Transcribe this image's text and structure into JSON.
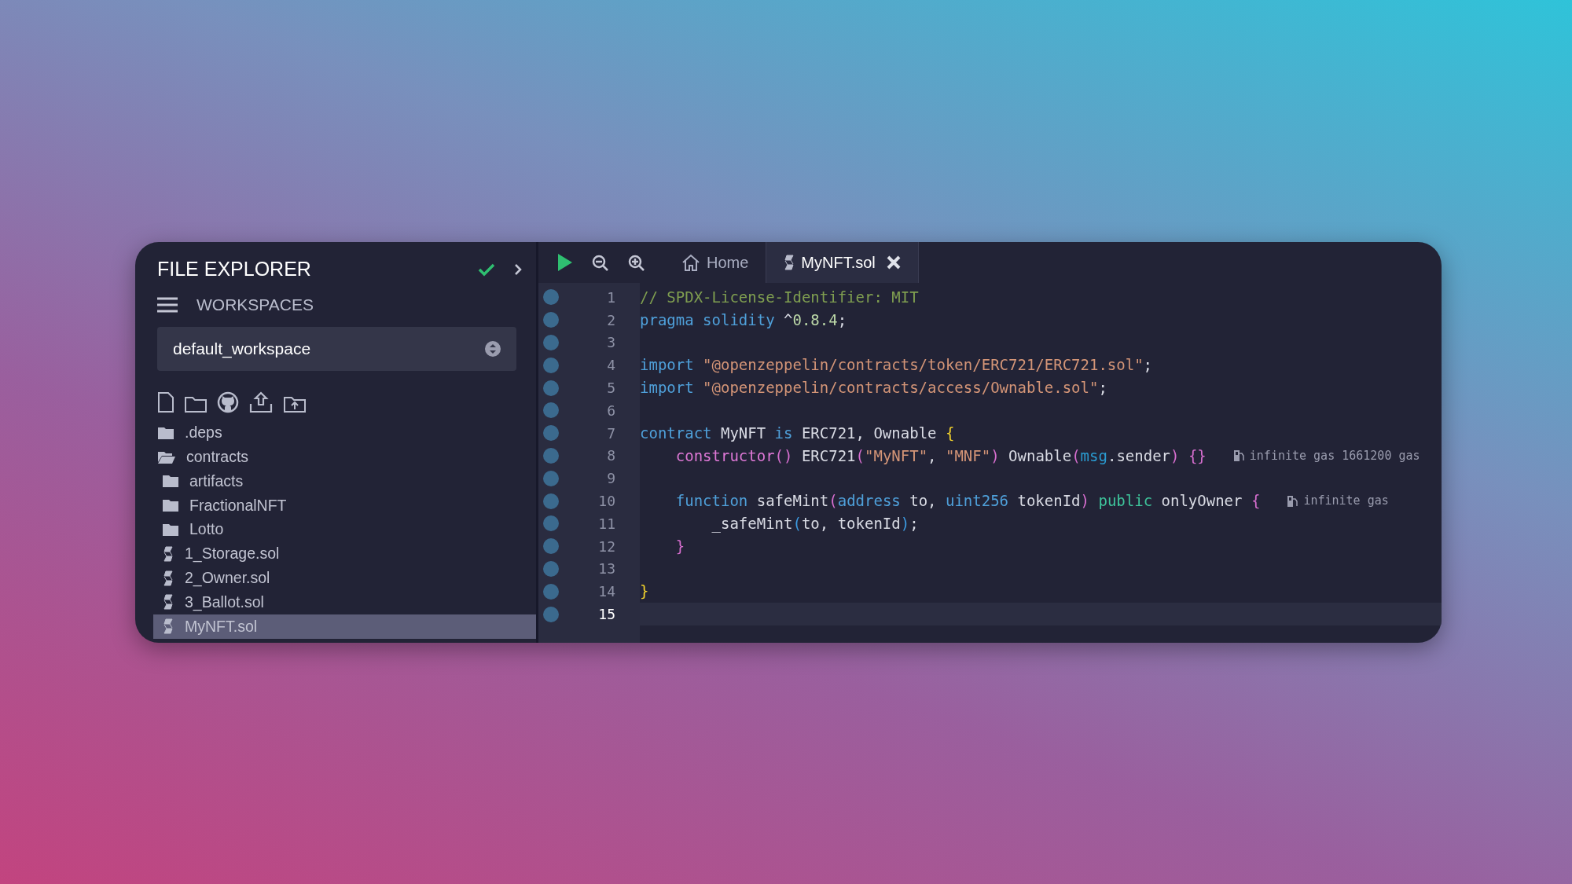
{
  "sidebar": {
    "title": "FILE EXPLORER",
    "section": "WORKSPACES",
    "workspace": "default_workspace",
    "tree": [
      {
        "kind": "folder",
        "label": ".deps",
        "expanded": false,
        "selected": false
      },
      {
        "kind": "folder",
        "label": "contracts",
        "expanded": true,
        "selected": false,
        "children": [
          {
            "kind": "folder",
            "label": "artifacts",
            "expanded": false,
            "selected": false
          },
          {
            "kind": "folder",
            "label": "FractionalNFT",
            "expanded": false,
            "selected": false
          },
          {
            "kind": "folder",
            "label": "Lotto",
            "expanded": false,
            "selected": false
          },
          {
            "kind": "file",
            "label": "1_Storage.sol",
            "selected": false
          },
          {
            "kind": "file",
            "label": "2_Owner.sol",
            "selected": false
          },
          {
            "kind": "file",
            "label": "3_Ballot.sol",
            "selected": false
          },
          {
            "kind": "file",
            "label": "MyNFT.sol",
            "selected": true
          }
        ]
      }
    ]
  },
  "editor": {
    "tabs": [
      {
        "kind": "home",
        "label": "Home",
        "selected": false,
        "closable": false
      },
      {
        "kind": "file",
        "label": "MyNFT.sol",
        "selected": true,
        "closable": true
      }
    ],
    "lines": [
      {
        "number": "1",
        "current": false,
        "tokens": [
          {
            "kind": "comment",
            "text": "// SPDX-License-Identifier: MIT"
          }
        ]
      },
      {
        "number": "2",
        "current": false,
        "tokens": [
          {
            "kind": "keyword",
            "text": "pragma"
          },
          {
            "kind": "keyword",
            "text": " solidity"
          },
          {
            "kind": "plain",
            "text": " ^"
          },
          {
            "kind": "number",
            "text": "0.8.4"
          },
          {
            "kind": "plain",
            "text": ";"
          }
        ]
      },
      {
        "number": "3",
        "current": false
      },
      {
        "number": "4",
        "current": false,
        "tokens": [
          {
            "kind": "keyword",
            "text": "import"
          },
          {
            "kind": "string",
            "text": " \"@openzeppelin/contracts/token/ERC721/ERC721.sol\""
          },
          {
            "kind": "plain",
            "text": ";"
          }
        ]
      },
      {
        "number": "5",
        "current": false,
        "tokens": [
          {
            "kind": "keyword",
            "text": "import"
          },
          {
            "kind": "string",
            "text": " \"@openzeppelin/contracts/access/Ownable.sol\""
          },
          {
            "kind": "plain",
            "text": ";"
          }
        ]
      },
      {
        "number": "6",
        "current": false
      },
      {
        "number": "7",
        "current": false,
        "tokens": [
          {
            "kind": "keyword",
            "text": "contract"
          },
          {
            "kind": "plain",
            "text": " MyNFT "
          },
          {
            "kind": "keyword",
            "text": "is"
          },
          {
            "kind": "plain",
            "text": " ERC721, Ownable "
          },
          {
            "kind": "bracket1",
            "text": "{"
          }
        ]
      },
      {
        "number": "8",
        "current": false,
        "gas": "infinite gas 1661200 gas",
        "tokens": [
          {
            "kind": "function",
            "text": "    constructor"
          },
          {
            "kind": "bracket2",
            "text": "()"
          },
          {
            "kind": "plain",
            "text": " ERC721"
          },
          {
            "kind": "bracket2",
            "text": "("
          },
          {
            "kind": "string",
            "text": "\"MyNFT\""
          },
          {
            "kind": "plain",
            "text": ", "
          },
          {
            "kind": "string",
            "text": "\"MNF\""
          },
          {
            "kind": "bracket2",
            "text": ")"
          },
          {
            "kind": "plain",
            "text": " Ownable"
          },
          {
            "kind": "bracket2",
            "text": "("
          },
          {
            "kind": "builtin",
            "text": "msg"
          },
          {
            "kind": "plain",
            "text": ".sender"
          },
          {
            "kind": "bracket2",
            "text": ")"
          },
          {
            "kind": "bracket2",
            "text": " {}"
          }
        ]
      },
      {
        "number": "9",
        "current": false
      },
      {
        "number": "10",
        "current": false,
        "gas": "infinite gas",
        "tokens": [
          {
            "kind": "keyword",
            "text": "    function"
          },
          {
            "kind": "plain",
            "text": " safeMint"
          },
          {
            "kind": "bracket2",
            "text": "("
          },
          {
            "kind": "keyword",
            "text": "address"
          },
          {
            "kind": "plain",
            "text": " to, "
          },
          {
            "kind": "keyword",
            "text": "uint256"
          },
          {
            "kind": "plain",
            "text": " tokenId"
          },
          {
            "kind": "bracket2",
            "text": ")"
          },
          {
            "kind": "modifier",
            "text": " public"
          },
          {
            "kind": "plain",
            "text": " onlyOwner "
          },
          {
            "kind": "bracket2",
            "text": "{"
          }
        ]
      },
      {
        "number": "11",
        "current": false,
        "tokens": [
          {
            "kind": "plain",
            "text": "        _safeMint"
          },
          {
            "kind": "bracket3",
            "text": "("
          },
          {
            "kind": "plain",
            "text": "to, tokenId"
          },
          {
            "kind": "bracket3",
            "text": ")"
          },
          {
            "kind": "plain",
            "text": ";"
          }
        ]
      },
      {
        "number": "12",
        "current": false,
        "tokens": [
          {
            "kind": "bracket2",
            "text": "    }"
          }
        ]
      },
      {
        "number": "13",
        "current": false
      },
      {
        "number": "14",
        "current": false,
        "tokens": [
          {
            "kind": "bracket1",
            "text": "}"
          }
        ]
      },
      {
        "number": "15",
        "current": true
      }
    ]
  }
}
